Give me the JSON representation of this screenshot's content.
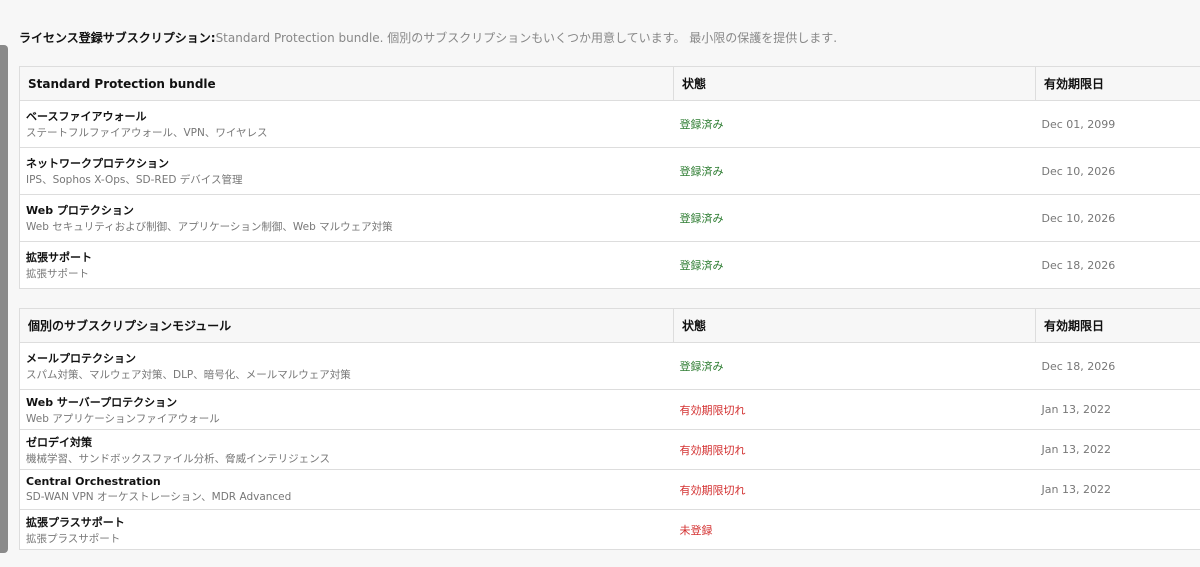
{
  "intro": {
    "label": "ライセンス登録サブスクリプション:",
    "text": "Standard Protection bundle. 個別のサブスクリプションもいくつか用意しています。 最小限の保護を提供します."
  },
  "bundle": {
    "headers": [
      "Standard Protection bundle",
      "状態",
      "有効期限日"
    ],
    "rows": [
      {
        "name": "ベースファイアウォール",
        "desc": "ステートフルファイアウォール、VPN、ワイヤレス",
        "status": "登録済み",
        "date": "Dec 01, 2099"
      },
      {
        "name": "ネットワークプロテクション",
        "desc": "IPS、Sophos X-Ops、SD-RED デバイス管理",
        "status": "登録済み",
        "date": "Dec 10, 2026"
      },
      {
        "name": "Web プロテクション",
        "desc": "Web セキュリティおよび制御、アプリケーション制御、Web マルウェア対策",
        "status": "登録済み",
        "date": "Dec 10, 2026"
      },
      {
        "name": "拡張サポート",
        "desc": "拡張サポート",
        "status": "登録済み",
        "date": "Dec 18, 2026"
      }
    ]
  },
  "modules": {
    "headers": [
      "個別のサブスクリプションモジュール",
      "状態",
      "有効期限日"
    ],
    "rows": [
      {
        "name": "メールプロテクション",
        "desc": "スパム対策、マルウェア対策、DLP、暗号化、メールマルウェア対策",
        "status": "登録済み",
        "date": "Dec 18, 2026"
      },
      {
        "name": "Web サーバープロテクション",
        "desc": "Web アプリケーションファイアウォール",
        "status": "有効期限切れ",
        "date": "Jan 13, 2022"
      },
      {
        "name": "ゼロデイ対策",
        "desc": "機械学習、サンドボックスファイル分析、脅威インテリジェンス",
        "status": "有効期限切れ",
        "date": "Jan 13, 2022"
      },
      {
        "name": "Central Orchestration",
        "desc": "SD-WAN VPN オーケストレーション、MDR Advanced",
        "status": "有効期限切れ",
        "date": "Jan 13, 2022"
      },
      {
        "name": "拡張プラスサポート",
        "desc": "拡張プラスサポート",
        "status": "未登録",
        "date": ""
      }
    ]
  },
  "colors": {
    "ok": "#2e7d32",
    "bad": "#d32f2f"
  }
}
